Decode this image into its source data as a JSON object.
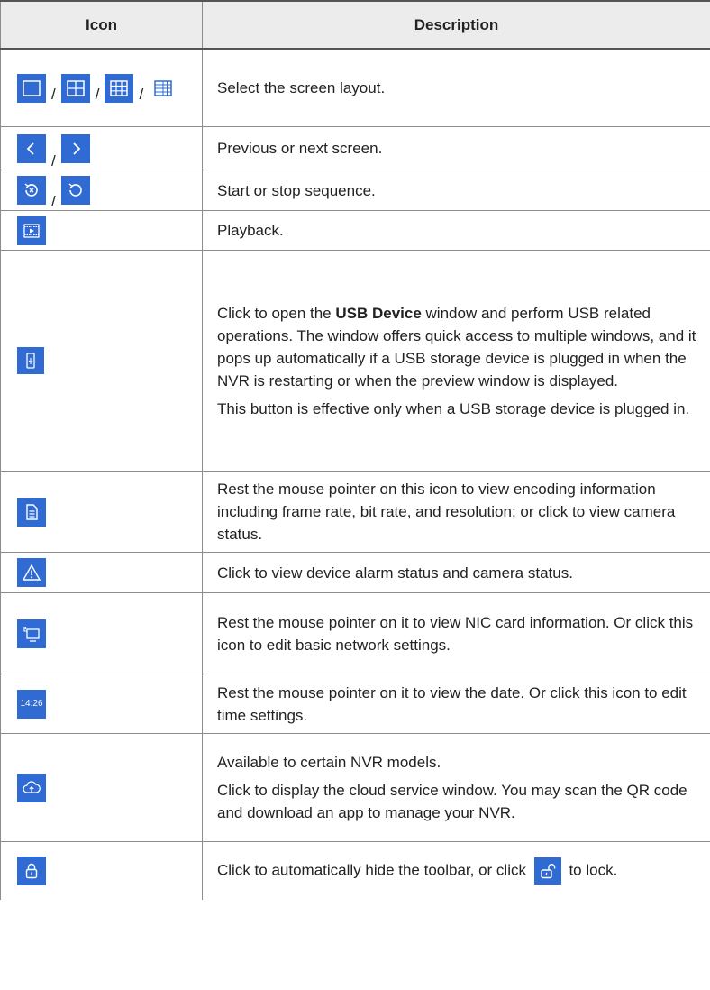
{
  "table": {
    "header": {
      "icon": "Icon",
      "description": "Description"
    },
    "rows": [
      {
        "icons": [
          "single-screen-layout-icon",
          "four-screen-layout-icon",
          "nine-screen-layout-icon",
          "sixteen-screen-layout-icon"
        ],
        "text": [
          "Select the screen layout."
        ]
      },
      {
        "icons": [
          "chevron-left-icon",
          "chevron-right-icon"
        ],
        "text": [
          "Previous or next screen."
        ]
      },
      {
        "icons": [
          "start-sequence-icon",
          "stop-sequence-icon"
        ],
        "text": [
          "Start or stop sequence."
        ]
      },
      {
        "icons": [
          "playback-icon"
        ],
        "text": [
          "Playback."
        ]
      },
      {
        "icons": [
          "usb-device-icon"
        ],
        "text_a": "Click to open the ",
        "text_bold": "USB Device",
        "text_b": " window and perform USB related operations. The window offers quick access to multiple windows, and it pops up automatically if a USB storage device is plugged in when the NVR is restarting or when the preview window is displayed.",
        "text_c": "This button is effective only when a USB storage device is plugged in."
      },
      {
        "icons": [
          "document-info-icon"
        ],
        "text": [
          "Rest the mouse pointer on this icon to view encoding information including frame rate, bit rate, and resolution; or click to view camera status."
        ]
      },
      {
        "icons": [
          "alarm-warning-icon"
        ],
        "text": [
          "Click to view device alarm status and camera status."
        ]
      },
      {
        "icons": [
          "network-nic-icon"
        ],
        "text": [
          "Rest the mouse pointer on it to view NIC card information. Or click this icon to edit basic network settings."
        ]
      },
      {
        "icons": [
          "time-display-icon"
        ],
        "time_label": "14:26",
        "text": [
          "Rest the mouse pointer on it to view the date. Or click this icon to edit time settings."
        ]
      },
      {
        "icons": [
          "cloud-upload-icon"
        ],
        "text": [
          "Available to certain NVR models.",
          "Click to display the cloud service window. You may scan the QR code and download an app to manage your NVR."
        ]
      },
      {
        "icons": [
          "lock-icon",
          "unlock-icon"
        ],
        "text_a": "Click to automatically hide the toolbar, or click ",
        "text_b": " to lock."
      }
    ]
  },
  "separator": "/",
  "colors": {
    "icon_bg": "#2f6bd3",
    "header_bg": "#ececec"
  }
}
